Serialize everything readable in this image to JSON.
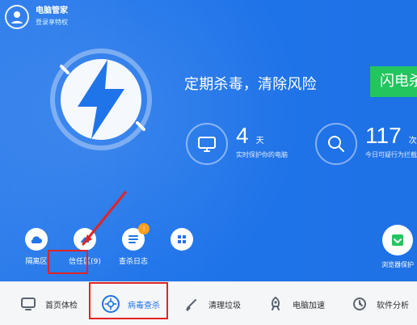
{
  "app": {
    "title": "电脑管家",
    "login_text": "登录享特权"
  },
  "hero": {
    "slogan": "定期杀毒，清除风险",
    "primary_button": "闪电杀",
    "stats": [
      {
        "value": "4",
        "unit": "天",
        "desc": "实时保护你的电脑"
      },
      {
        "value": "117",
        "unit": "次",
        "desc": "今日可疑行为拦截"
      }
    ]
  },
  "quick_tools": [
    {
      "label": "隔离区",
      "icon": "cloud-icon"
    },
    {
      "label": "信任区(9)",
      "icon": "trust-hand-icon"
    },
    {
      "label": "查杀日志",
      "icon": "log-icon",
      "badge": "!"
    },
    {
      "label": "",
      "icon": "windows-icon"
    }
  ],
  "browser_protection": {
    "label": "浏览器保护",
    "icon": "browser-shield-icon"
  },
  "bottom_nav": [
    {
      "label": "首页体检",
      "icon": "monitor-icon"
    },
    {
      "label": "病毒查杀",
      "icon": "virus-scan-icon",
      "active": true
    },
    {
      "label": "清理垃圾",
      "icon": "broom-icon"
    },
    {
      "label": "电脑加速",
      "icon": "rocket-icon"
    },
    {
      "label": "软件分析",
      "icon": "software-icon"
    }
  ],
  "colors": {
    "primary_blue": "#1f74ea",
    "green_button": "#22c55e",
    "highlight_red": "#e02424",
    "badge_orange": "#ff9f1a"
  }
}
